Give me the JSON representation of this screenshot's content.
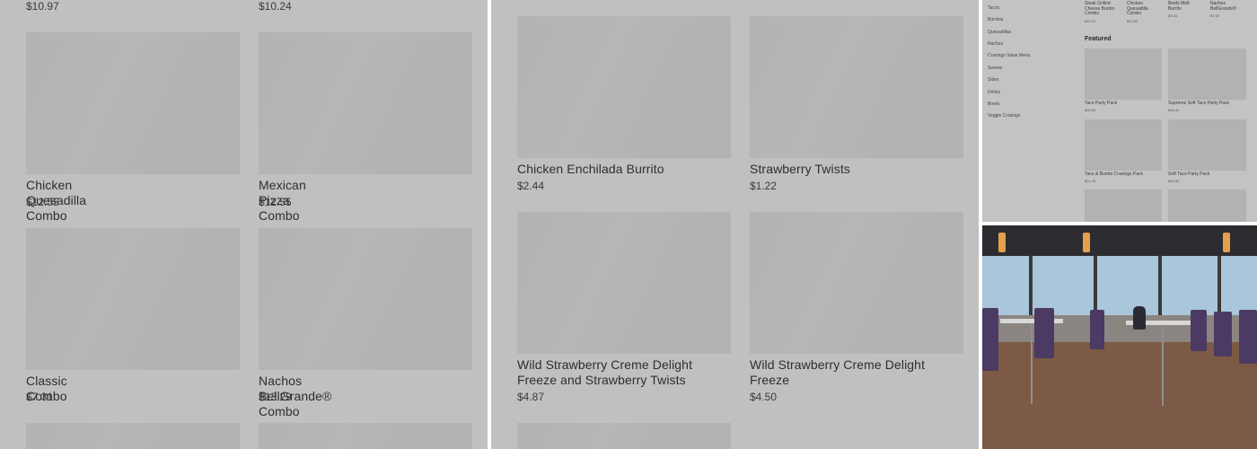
{
  "panel1": {
    "top_prices": [
      "$10.97",
      "$10.24"
    ],
    "items": [
      {
        "title": "Chicken Quesadilla Combo",
        "price": "$12.55"
      },
      {
        "title": "Mexican Pizza Combo",
        "price": "$12.55"
      },
      {
        "title": "Classic Combo",
        "price": "$7.31"
      },
      {
        "title": "Nachos BellGrande® Combo",
        "price": "$13.29"
      }
    ]
  },
  "panel2": {
    "items": [
      {
        "title": "Chicken Enchilada Burrito",
        "price": "$2.44"
      },
      {
        "title": "Strawberry Twists",
        "price": "$1.22"
      },
      {
        "title": "Wild Strawberry Creme Delight Freeze and Strawberry Twists",
        "price": "$4.87"
      },
      {
        "title": "Wild Strawberry Creme Delight Freeze",
        "price": "$4.50"
      }
    ]
  },
  "panel3": {
    "sidebar": [
      "Tacos",
      "Burritos",
      "Quesadillas",
      "Nachos",
      "Cravings Value Menu",
      "Sweets",
      "Sides",
      "Drinks",
      "Bowls",
      "Veggie Cravings"
    ],
    "top_items": [
      {
        "title": "Steak Grilled Cheese Burrito Combo",
        "price": "$10.97"
      },
      {
        "title": "Chicken Quesadilla Combo",
        "price": "$12.55"
      },
      {
        "title": "Beefy Melt Burrito",
        "price": "$2.44"
      },
      {
        "title": "Nachos BellGrande®",
        "price": "$7.92"
      }
    ],
    "section_title": "Featured",
    "featured": [
      {
        "title": "Taco Party Pack",
        "price": "$26.83"
      },
      {
        "title": "Supreme Soft Taco Party Pack",
        "price": "$36.42"
      },
      {
        "title": "Taco & Burrito Cravings Pack",
        "price": "$21.78"
      },
      {
        "title": "Soft Taco Party Pack",
        "price": "$26.83"
      }
    ]
  },
  "colors": {
    "panel_bg": "#c0c0c0",
    "thumb_bg": "#b3b3b3",
    "text_dark": "#2e2e2e",
    "chair_purple": "#4b3a63"
  }
}
